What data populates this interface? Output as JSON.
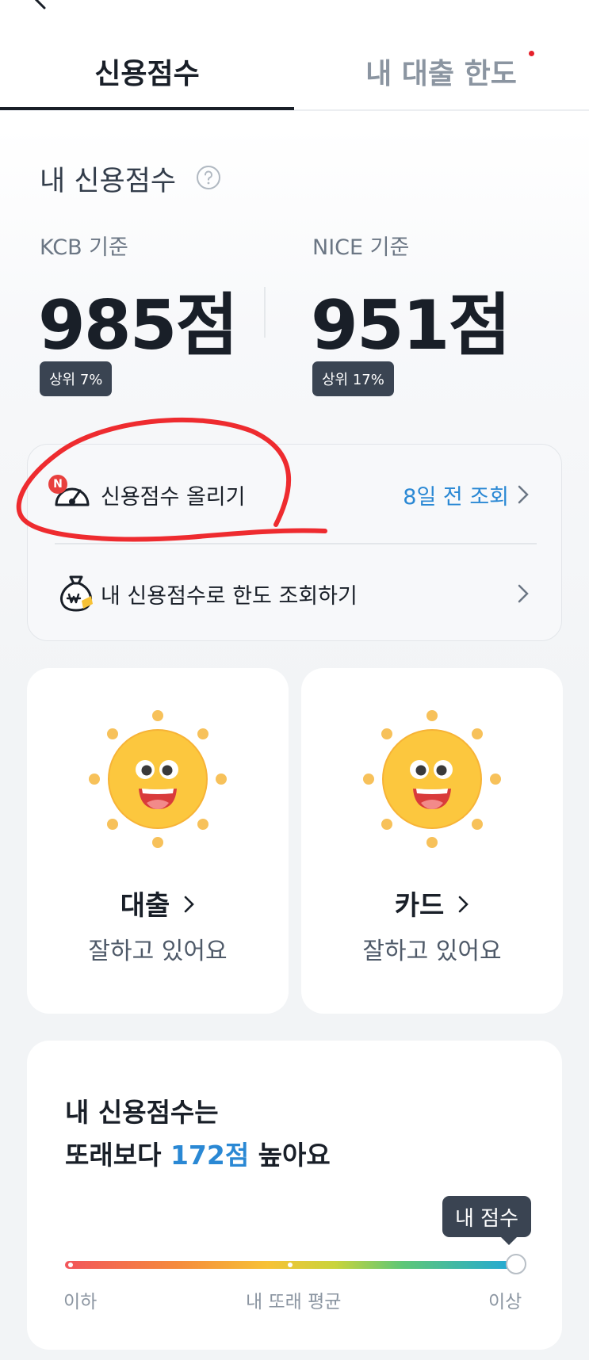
{
  "tabs": [
    {
      "label": "신용점수",
      "active": true
    },
    {
      "label": "내 대출 한도",
      "has_notification": true
    }
  ],
  "score_section": {
    "title": "내 신용점수",
    "kcb": {
      "label": "KCB 기준",
      "score": "985점",
      "rank": "상위 7%"
    },
    "nice": {
      "label": "NICE 기준",
      "score": "951점",
      "rank": "상위 17%"
    }
  },
  "actions": {
    "raise_score": {
      "badge": "N",
      "label": "신용점수 올리기",
      "right_text": "8일 전 조회"
    },
    "check_limit": {
      "label": "내 신용점수로 한도 조회하기"
    }
  },
  "grades": [
    {
      "name": "대출",
      "status": "잘하고 있어요"
    },
    {
      "name": "카드",
      "status": "잘하고 있어요"
    }
  ],
  "comparison": {
    "line1": "내 신용점수는",
    "line2_prefix": "또래보다 ",
    "line2_highlight": "172점",
    "line2_suffix": " 높아요",
    "tooltip": "내 점수",
    "labels": {
      "low": "이하",
      "mid": "내 또래 평균",
      "high": "이상"
    },
    "my_position_fraction": 1.0
  },
  "colors": {
    "accent_blue": "#2a88d4",
    "badge_dark": "#3a4452",
    "notification_red": "#e5212b"
  },
  "icons": [
    "back-arrow-icon",
    "help-icon",
    "gauge-icon",
    "money-bag-icon",
    "chevron-right-icon",
    "sun-face-icon"
  ]
}
